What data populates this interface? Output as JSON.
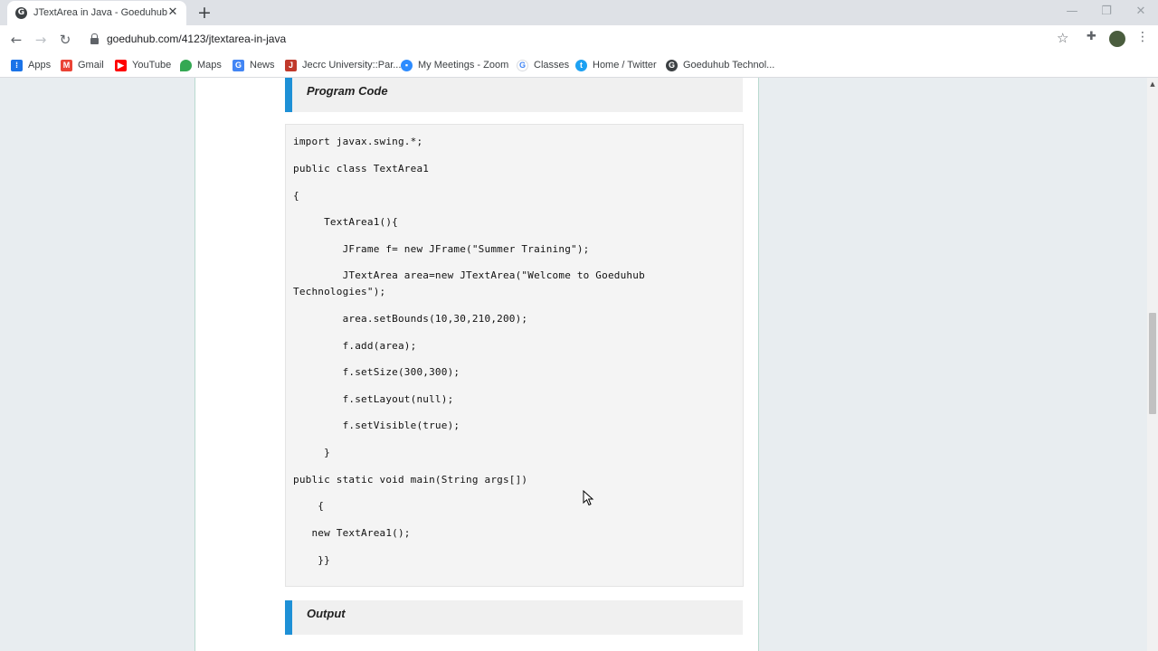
{
  "browser": {
    "tab": {
      "title": "JTextArea in Java - Goeduhub Te",
      "favicon": "G"
    },
    "url": "goeduhub.com/4123/jtextarea-in-java"
  },
  "bookmarks": [
    {
      "label": "Apps",
      "icon": "apps-grid-icon",
      "color": "#1a73e8"
    },
    {
      "label": "Gmail",
      "icon": "gmail-icon",
      "color": "#ea4335"
    },
    {
      "label": "YouTube",
      "icon": "youtube-icon",
      "color": "#ff0000"
    },
    {
      "label": "Maps",
      "icon": "maps-pin-icon",
      "color": "#34a853"
    },
    {
      "label": "News",
      "icon": "news-icon",
      "color": "#4285f4"
    },
    {
      "label": "Jecrc University::Par...",
      "icon": "jecrc-icon",
      "color": "#c0392b"
    },
    {
      "label": "My Meetings - Zoom",
      "icon": "zoom-icon",
      "color": "#2d8cff"
    },
    {
      "label": "Classes",
      "icon": "google-classes-icon",
      "color": "#4285f4"
    },
    {
      "label": "Home / Twitter",
      "icon": "twitter-icon",
      "color": "#1da1f2"
    },
    {
      "label": "Goeduhub Technol...",
      "icon": "goeduhub-icon",
      "color": "#3c4043"
    }
  ],
  "sections": {
    "program_code": "Program Code",
    "output": "Output"
  },
  "code_lines": [
    "import javax.swing.*;",
    "public class TextArea1",
    "{",
    "     TextArea1(){",
    "        JFrame f= new JFrame(\"Summer Training\");",
    "        JTextArea area=new JTextArea(\"Welcome to Goeduhub",
    "Technologies\");",
    "        area.setBounds(10,30,210,200);",
    "        f.add(area);",
    "        f.setSize(300,300);",
    "        f.setLayout(null);",
    "        f.setVisible(true);",
    "     }",
    "public static void main(String args[])",
    "    {",
    "   new TextArea1();",
    "    }}"
  ],
  "colors": {
    "accent_bar": "#1e90d6",
    "content_border": "#b9d9cf"
  }
}
